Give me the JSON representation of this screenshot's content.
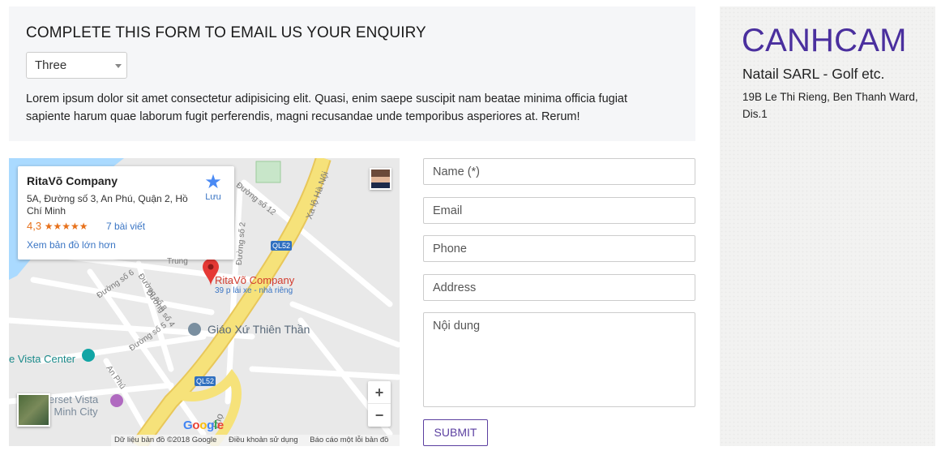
{
  "enquiry": {
    "heading": "COMPLETE THIS FORM TO EMAIL US YOUR ENQUIRY",
    "select_value": "Three",
    "description": "Lorem ipsum dolor sit amet consectetur adipisicing elit. Quasi, enim saepe suscipit nam beatae minima officia fugiat sapiente harum quae laborum fugit perferendis, magni recusandae unde temporibus asperiores at. Rerum!"
  },
  "map": {
    "place_name": "RitaVõ Company",
    "place_address": "5A, Đường số 3, An Phú, Quận 2, Hồ Chí Minh",
    "rating": "4,3",
    "stars": "★★★★★",
    "reviews": "7 bài viết",
    "larger_map": "Xem bản đồ lớn hơn",
    "save_label": "Lưu",
    "pin_label": "RitaVõ Company",
    "pin_sub": "39 p lái xe - nhà riêng",
    "poi_church": "Giáo Xứ Thiên Thần",
    "poi_vista": "e Vista Center",
    "poi_somerset_1": "erset Vista",
    "poi_somerset_2": "i Minh City",
    "road_ql52": "QL52",
    "road_ha_noi": "Xa lộ Hà Nội",
    "road_so12": "Đường số 12",
    "road_so2": "Đường số 2",
    "road_so6": "Đường số 6",
    "road_so8": "Đường số 8",
    "road_so4": "Đường số 4",
    "road_so5": "Đường số 5",
    "road_an_phu": "An Phú",
    "road_tho": "Thọ",
    "road_trung": "Trung",
    "google": "Google",
    "footer_data": "Dữ liệu bản đồ ©2018 Google",
    "footer_terms": "Điều khoản sử dụng",
    "footer_report": "Báo cáo một lỗi bản đồ",
    "zoom_in": "+",
    "zoom_out": "−"
  },
  "form": {
    "name_placeholder": "Name (*)",
    "email_placeholder": "Email",
    "phone_placeholder": "Phone",
    "address_placeholder": "Address",
    "content_placeholder": "Nội dung",
    "submit_label": "SUBMIT"
  },
  "aside": {
    "logo": "CANHCAM",
    "company": "Natail SARL - Golf etc.",
    "address": "19B Le Thi Rieng, Ben Thanh Ward, Dis.1"
  },
  "colors": {
    "brand": "#4a2f9e",
    "submit_border": "#5b3fa0",
    "link": "#3a75c4",
    "pin": "#e53935",
    "highway": "#f6e27a"
  },
  "icons": [
    "star-icon",
    "map-pin-icon",
    "church-icon",
    "landmark-icon",
    "hotel-icon",
    "zoom-in-icon",
    "zoom-out-icon",
    "dropdown-caret-icon"
  ]
}
